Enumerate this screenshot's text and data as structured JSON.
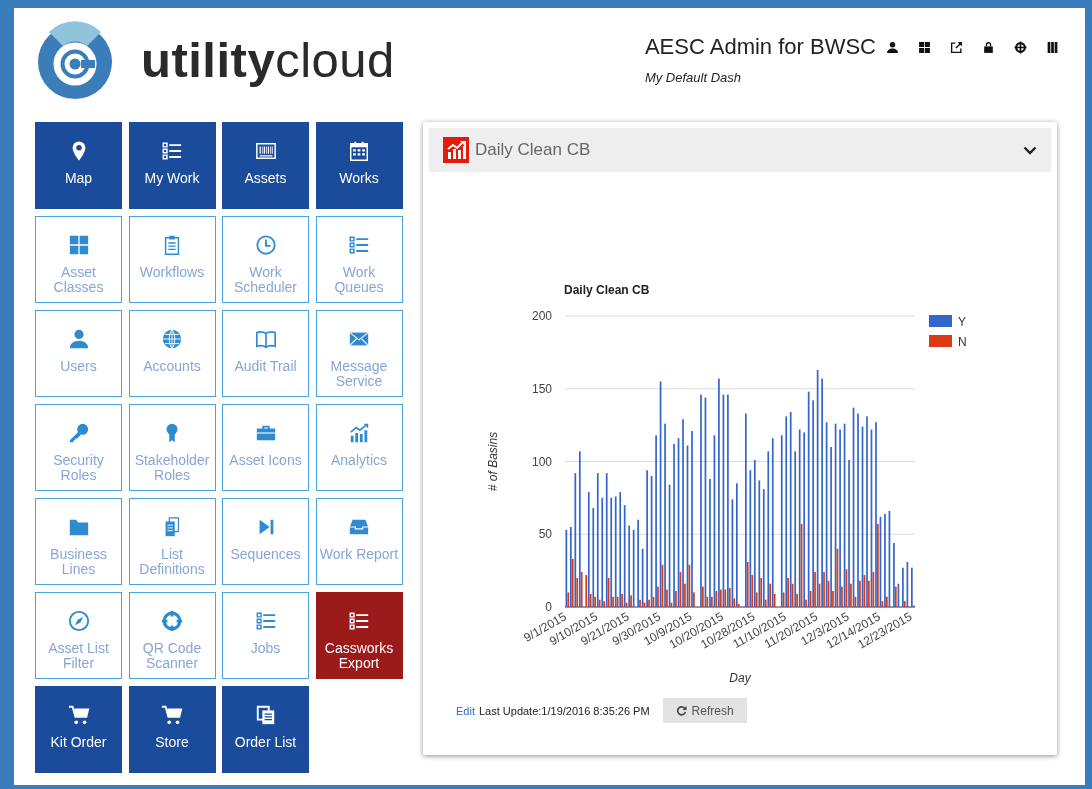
{
  "logo": {
    "text": "**utility**cloud"
  },
  "user": {
    "name": "AESC Admin for BWSC",
    "dashboard": "My Default Dash"
  },
  "tiles": [
    {
      "label": "Map",
      "kind": "primary"
    },
    {
      "label": "My Work",
      "kind": "primary"
    },
    {
      "label": "Assets",
      "kind": "primary"
    },
    {
      "label": "Works",
      "kind": "primary"
    },
    {
      "label": "Asset Classes",
      "kind": "outline"
    },
    {
      "label": "Workflows",
      "kind": "outline"
    },
    {
      "label": "Work Scheduler",
      "kind": "outline"
    },
    {
      "label": "Work Queues",
      "kind": "outline"
    },
    {
      "label": "Users",
      "kind": "outline"
    },
    {
      "label": "Accounts",
      "kind": "outline"
    },
    {
      "label": "Audit Trail",
      "kind": "outline"
    },
    {
      "label": "Message Service",
      "kind": "outline"
    },
    {
      "label": "Security Roles",
      "kind": "outline"
    },
    {
      "label": "Stakeholder Roles",
      "kind": "outline"
    },
    {
      "label": "Asset Icons",
      "kind": "outline"
    },
    {
      "label": "Analytics",
      "kind": "outline"
    },
    {
      "label": "Business Lines",
      "kind": "outline"
    },
    {
      "label": "List Definitions",
      "kind": "outline"
    },
    {
      "label": "Sequences",
      "kind": "outline"
    },
    {
      "label": "Work Report",
      "kind": "outline"
    },
    {
      "label": "Asset List Filter",
      "kind": "outline"
    },
    {
      "label": "QR Code Scanner",
      "kind": "outline"
    },
    {
      "label": "Jobs",
      "kind": "outline"
    },
    {
      "label": "Cassworks Export",
      "kind": "highlight"
    },
    {
      "label": "Kit Order",
      "kind": "primary"
    },
    {
      "label": "Store",
      "kind": "primary"
    },
    {
      "label": "Order List",
      "kind": "primary"
    }
  ],
  "widget": {
    "title": "Daily Clean CB",
    "chart_data": {
      "type": "bar",
      "title": "Daily Clean CB",
      "xlabel": "Day",
      "ylabel": "# of Basins",
      "categories": [
        "9/1/2015",
        null,
        null,
        null,
        null,
        null,
        null,
        "9/10/2015",
        null,
        null,
        null,
        null,
        null,
        null,
        "9/21/2015",
        null,
        null,
        null,
        null,
        null,
        null,
        "9/30/2015",
        null,
        null,
        null,
        null,
        null,
        null,
        "10/9/2015",
        null,
        null,
        null,
        null,
        null,
        null,
        "10/20/2015",
        null,
        null,
        null,
        null,
        null,
        null,
        "10/28/2015",
        null,
        null,
        null,
        null,
        null,
        null,
        "11/10/2015",
        null,
        null,
        null,
        null,
        null,
        null,
        "11/20/2015",
        null,
        null,
        null,
        null,
        null,
        null,
        "12/3/2015",
        null,
        null,
        null,
        null,
        null,
        null,
        "12/14/2015",
        null,
        null,
        null,
        null,
        null,
        null,
        "12/23/2015"
      ],
      "series": [
        {
          "name": "Y",
          "color": "#3366cc",
          "values": [
            53,
            55,
            92,
            107,
            0,
            79,
            68,
            92,
            75,
            92,
            75,
            76,
            79,
            70,
            56,
            53,
            60,
            40,
            94,
            90,
            118,
            155,
            126,
            84,
            112,
            116,
            129,
            111,
            121,
            0,
            146,
            144,
            88,
            118,
            157,
            146,
            146,
            74,
            85,
            0,
            133,
            94,
            101,
            87,
            81,
            107,
            116,
            0,
            118,
            131,
            134,
            107,
            122,
            120,
            148,
            142,
            163,
            157,
            127,
            110,
            126,
            122,
            126,
            101,
            137,
            133,
            124,
            131,
            122,
            127,
            62,
            64,
            66,
            44,
            16,
            27,
            31,
            27
          ]
        },
        {
          "name": "N",
          "color": "#dc3912",
          "values": [
            10,
            33,
            20,
            24,
            22,
            9,
            7,
            5,
            4,
            20,
            7,
            7,
            9,
            3,
            8,
            0,
            5,
            3,
            5,
            7,
            14,
            29,
            12,
            3,
            11,
            24,
            16,
            29,
            10,
            null,
            14,
            7,
            7,
            11,
            12,
            12,
            13,
            6,
            2,
            0,
            31,
            22,
            10,
            20,
            5,
            16,
            9,
            0,
            10,
            20,
            16,
            9,
            57,
            5,
            11,
            24,
            16,
            24,
            18,
            11,
            40,
            14,
            26,
            16,
            7,
            18,
            22,
            18,
            24,
            57,
            4,
            7,
            0,
            14,
            0,
            4,
            0,
            1
          ]
        }
      ],
      "ylim": [
        0,
        200
      ],
      "yticks": [
        0,
        50,
        100,
        150,
        200
      ],
      "grid": true,
      "legend": "right"
    },
    "footer": {
      "edit_link": "Edit",
      "last_update": "Last Update:1/19/2016 8:35:26 PM",
      "refresh_button": "Refresh"
    }
  }
}
